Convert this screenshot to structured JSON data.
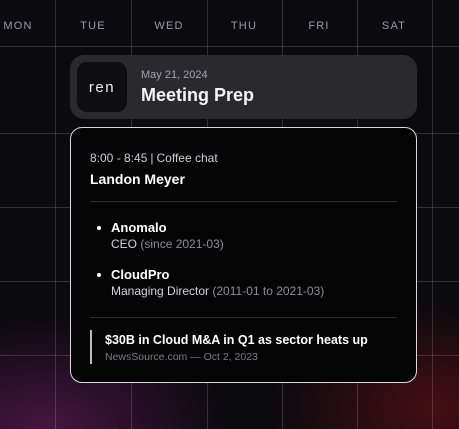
{
  "calendar": {
    "days": [
      "MON",
      "TUE",
      "WED",
      "THU",
      "FRI",
      "SAT"
    ]
  },
  "header": {
    "logo_text": "ren",
    "date": "May 21, 2024",
    "title": "Meeting Prep"
  },
  "event": {
    "time": "8:00 - 8:45",
    "separator": "|",
    "type": "Coffee chat",
    "person": "Landon Meyer"
  },
  "experience": [
    {
      "company": "Anomalo",
      "role": "CEO",
      "dates": "(since 2021-03)"
    },
    {
      "company": "CloudPro",
      "role": "Managing Director",
      "dates": "(2011-01 to 2021-03)"
    }
  ],
  "news": {
    "title": "$30B in Cloud M&A in Q1 as sector heats up",
    "source": "NewsSource.com — Oct 2, 2023"
  }
}
